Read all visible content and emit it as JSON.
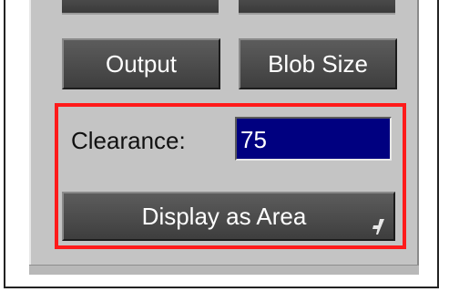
{
  "panel": {
    "buttons": {
      "output_label": "Output",
      "blob_size_label": "Blob Size"
    },
    "clearance": {
      "label": "Clearance:",
      "value": "75"
    },
    "display_mode": {
      "selected": "Display as Area"
    }
  }
}
